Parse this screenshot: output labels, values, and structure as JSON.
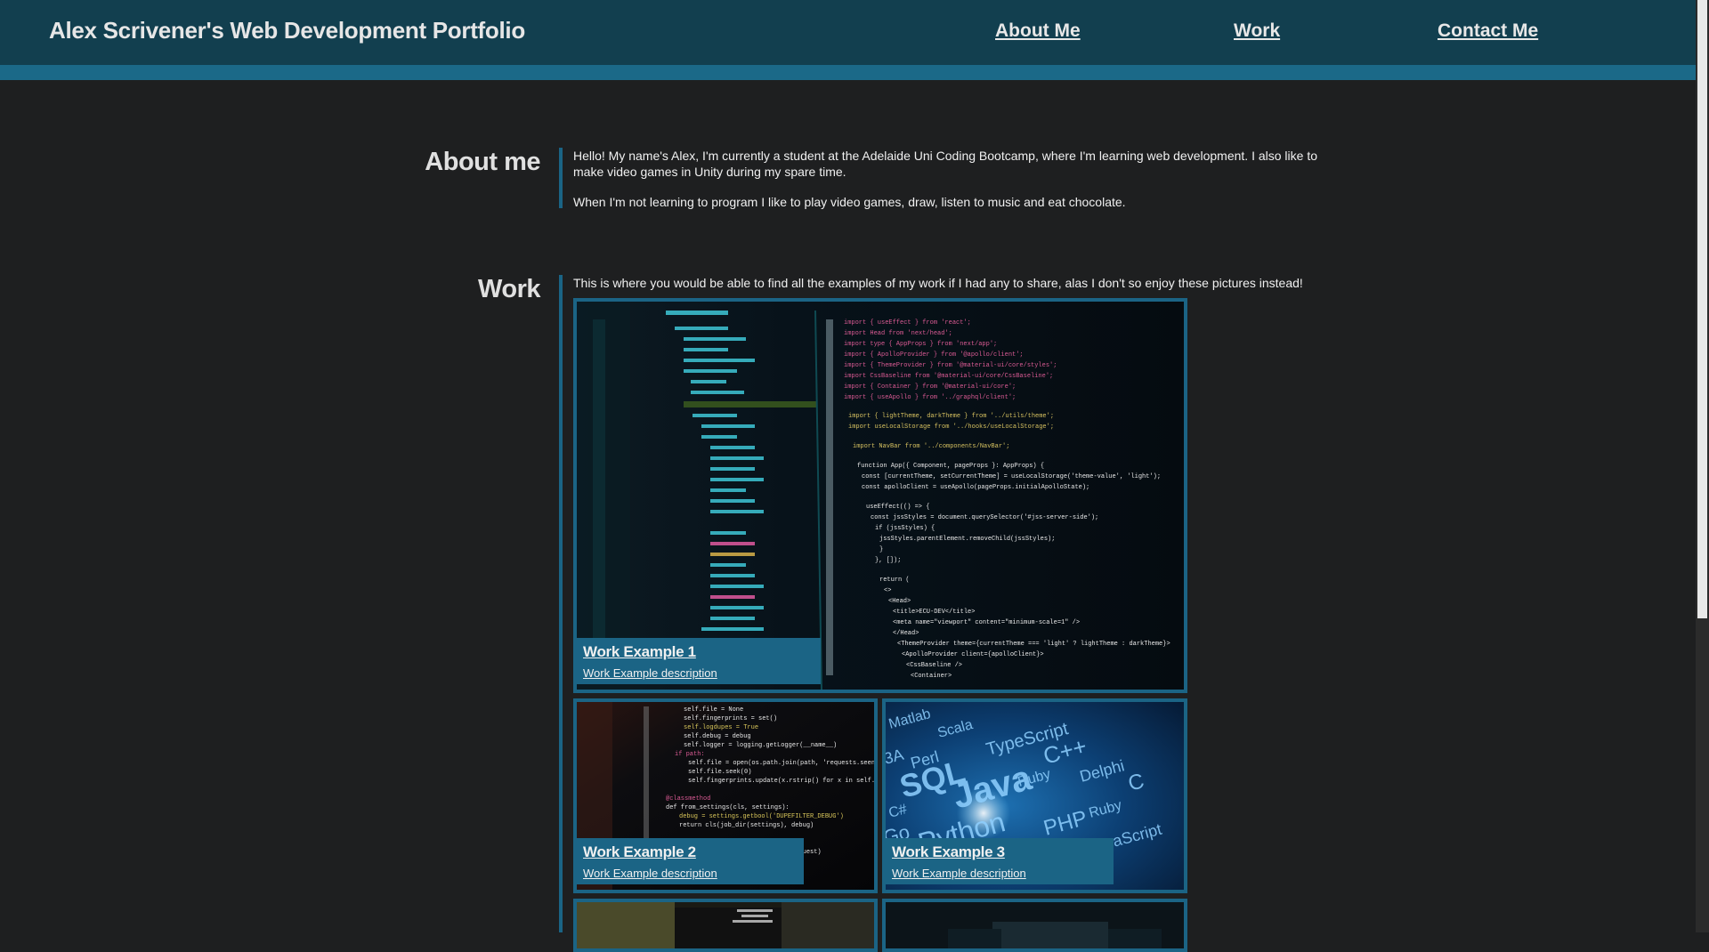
{
  "header": {
    "title": "Alex Scrivener's Web Development Portfolio",
    "nav": [
      "About Me",
      "Work",
      "Contact Me"
    ]
  },
  "about": {
    "heading": "About me",
    "paragraphs": [
      "Hello! My name's Alex, I'm currently a student at the Adelaide Uni Coding Bootcamp, where I'm learning web development. I also like to make video games in Unity during my spare time.",
      "When I'm not learning to program I like to play video games, draw, listen to music and eat chocolate."
    ]
  },
  "work": {
    "heading": "Work",
    "intro": "This is where you would be able to find all the examples of my work if I had any to share, alas I don't so enjoy these pictures instead!",
    "examples": [
      {
        "title": "Work Example 1",
        "description": "Work Example description",
        "image": "code-editor-screenshot"
      },
      {
        "title": "Work Example 2",
        "description": "Work Example description",
        "image": "python-code-screen"
      },
      {
        "title": "Work Example 3",
        "description": "Work Example description",
        "image": "programming-languages-cloud"
      },
      {
        "title": "",
        "description": "",
        "image": "laptop-code"
      },
      {
        "title": "",
        "description": "",
        "image": "desk-monitors"
      }
    ]
  },
  "colors": {
    "header_bg": "#123f4f",
    "accent": "#1b6485",
    "page_bg": "#1e1f20"
  }
}
